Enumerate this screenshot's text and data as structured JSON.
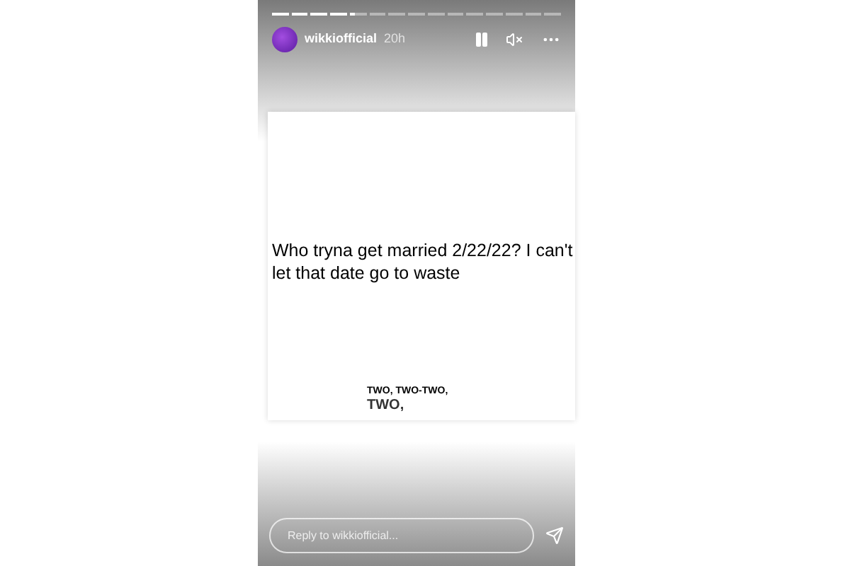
{
  "progress": [
    {
      "viewed": true,
      "selected": false
    },
    {
      "viewed": true,
      "selected": false
    },
    {
      "viewed": true,
      "selected": false
    },
    {
      "viewed": true,
      "selected": false
    },
    {
      "viewed": false,
      "selected": true
    },
    {
      "viewed": false,
      "selected": false
    },
    {
      "viewed": false,
      "selected": false
    },
    {
      "viewed": false,
      "selected": false
    },
    {
      "viewed": false,
      "selected": false
    },
    {
      "viewed": false,
      "selected": false
    },
    {
      "viewed": false,
      "selected": false
    },
    {
      "viewed": false,
      "selected": false
    },
    {
      "viewed": false,
      "selected": false
    },
    {
      "viewed": false,
      "selected": false
    },
    {
      "viewed": false,
      "selected": false
    }
  ],
  "header": {
    "username": "wikkiofficial",
    "time": "20h",
    "paused": false,
    "muted": true
  },
  "post": {
    "caption": "Who tryna get married 2/22/22? I can't let that date go to waste",
    "lyrics_1": "TWO, TWO-TWO,",
    "lyrics_2": "TWO,"
  },
  "reply": {
    "placeholder": "Reply to wikkiofficial..."
  }
}
